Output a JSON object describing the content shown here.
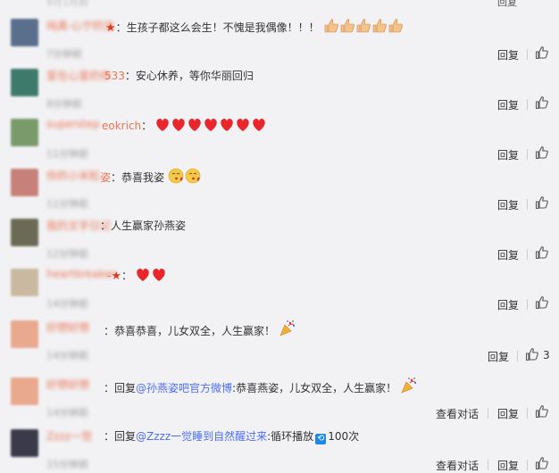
{
  "top_partial": {
    "time": "9月1月前",
    "reply_label": "回复"
  },
  "labels": {
    "reply": "回复",
    "view_conversation": "查看对话"
  },
  "colors": {
    "accent_name": "#eb7350",
    "link": "#4e6ef2",
    "star": "#e03c1c"
  },
  "comments": [
    {
      "name_blurred": "纯真·心宁的宝",
      "name_clear": "",
      "star": "★",
      "text": "：生孩子都这么会生！不愧是我偶像！！！",
      "emoji": "thumbs-up x5",
      "time": "7分钟前",
      "likes": "",
      "avatar_color": "#5a6f8c"
    },
    {
      "name_blurred": "爱在心里的你",
      "name_clear": "533",
      "star": "",
      "text": "：安心休养，等你华丽回归",
      "emoji": "",
      "time": "8分钟前",
      "likes": "",
      "avatar_color": "#3e7a6b"
    },
    {
      "name_blurred": "superstep",
      "name_clear": "eokrich",
      "star": "",
      "text": "：",
      "emoji": "red-heart x7",
      "time": "11分钟前",
      "likes": "",
      "avatar_color": "#7a9a6c"
    },
    {
      "name_blurred": "你的小米粒",
      "name_clear": "姿",
      "star": "",
      "text": "：恭喜我姿",
      "emoji": "kiss-face x2",
      "time": "11分钟前",
      "likes": "",
      "avatar_color": "#c7817a"
    },
    {
      "name_blurred": "我的文字日记",
      "name_clear": "",
      "star": "",
      "text": "：人生赢家孙燕姿",
      "emoji": "",
      "time": "12分钟前",
      "likes": "",
      "avatar_color": "#6b6b55"
    },
    {
      "name_blurred": "heartbreaker",
      "name_clear": "-",
      "star": "★",
      "text": "：",
      "emoji": "red-heart x2",
      "time": "14分钟前",
      "likes": "",
      "avatar_color": "#c9b9a0"
    },
    {
      "name_blurred": "好想好想",
      "name_clear": "",
      "star": "",
      "text": "：恭喜恭喜，儿女双全，人生赢家！",
      "emoji": "party-popper",
      "time": "14分钟前",
      "likes": "3",
      "avatar_color": "#e9a98f"
    },
    {
      "name_blurred": "好想好想",
      "name_clear": "",
      "star": "",
      "prefix": "：回复",
      "link": "@孙燕姿吧官方微博",
      "text": ":恭喜燕姿，儿女双全，人生赢家！",
      "emoji": "party-popper",
      "time": "14分钟前",
      "likes": "",
      "view": true,
      "avatar_color": "#e9a98f"
    },
    {
      "name_blurred": "Zzzz一觉",
      "name_clear": "",
      "star": "",
      "prefix": "：回复",
      "link": "@Zzzz一觉睡到自然醒过来",
      "text": ":循环播放",
      "extra": "100次",
      "emoji": "repeat-badge",
      "time": "15分钟前",
      "likes": "",
      "view": true,
      "avatar_color": "#3a3a4a"
    }
  ]
}
